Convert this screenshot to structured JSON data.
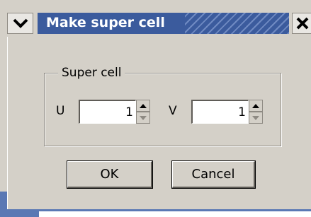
{
  "window": {
    "title": "Make super cell"
  },
  "group": {
    "label": "Super cell"
  },
  "fields": {
    "u": {
      "label": "U",
      "value": "1"
    },
    "v": {
      "label": "V",
      "value": "1"
    }
  },
  "buttons": {
    "ok": "OK",
    "cancel": "Cancel"
  },
  "icons": {
    "menu": "chevron-down-icon",
    "close": "close-icon",
    "spin_up": "up-arrow-icon",
    "spin_down": "down-arrow-icon"
  },
  "colors": {
    "titlebar": "#3b5b9d",
    "dialog_bg": "#d4d0c8"
  }
}
